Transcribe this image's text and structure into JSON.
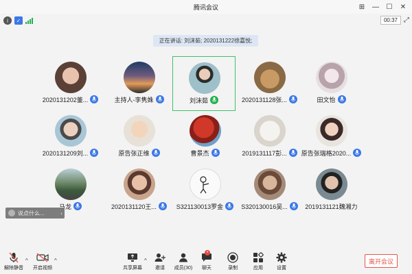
{
  "window": {
    "title": "腾讯会议"
  },
  "infobar": {
    "timer": "00:37"
  },
  "speaking": {
    "text": "正在讲话: 刘沫茹; 2020131222徐嘉悦;"
  },
  "participants": [
    {
      "name": "2020131202董..."
    },
    {
      "name": "主持人-李隽姝"
    },
    {
      "name": "刘沫茹"
    },
    {
      "name": "2020131128张..."
    },
    {
      "name": "田文怡"
    },
    {
      "name": "2020131209刘..."
    },
    {
      "name": "原告张正维"
    },
    {
      "name": "曹景杰"
    },
    {
      "name": "2019131117彭..."
    },
    {
      "name": "原告张瑞格2020..."
    },
    {
      "name": "马龙"
    },
    {
      "name": "2020131120王..."
    },
    {
      "name": "S321130013罗金"
    },
    {
      "name": "S320130016吴..."
    },
    {
      "name": "2019131121魏湘力"
    }
  ],
  "chat": {
    "placeholder": "说点什么..."
  },
  "toolbar": {
    "unmute": "解除静音",
    "video": "开启视频",
    "share": "共享屏幕",
    "invite": "邀请",
    "members": "成员(30)",
    "chat": "聊天",
    "record": "录制",
    "apps": "应用",
    "settings": "设置",
    "leave": "离开会议"
  },
  "colors": {
    "accent": "#3b78e7",
    "speaking_green": "#23b04e",
    "leave_red": "#e3564a"
  }
}
